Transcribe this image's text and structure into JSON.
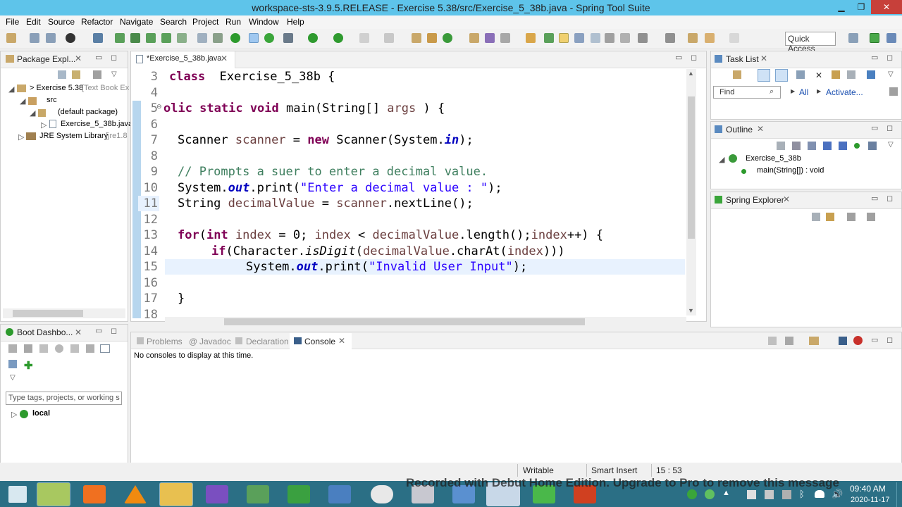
{
  "window": {
    "title": "workspace-sts-3.9.5.RELEASE - Exercise 5.38/src/Exercise_5_38b.java - Spring Tool Suite",
    "minimize": "▁",
    "maximize": "❐",
    "close": "✕"
  },
  "menu": [
    "File",
    "Edit",
    "Source",
    "Refactor",
    "Navigate",
    "Search",
    "Project",
    "Run",
    "Window",
    "Help"
  ],
  "toolbar": {
    "quick_access": "Quick Access"
  },
  "package_explorer": {
    "tab": "Package Expl...",
    "project": "> Exercise 5.38",
    "project_suffix": "[Text Book Ex",
    "src": "src",
    "default_package": "(default package)",
    "file": "Exercise_5_38b.java",
    "jre": "JRE System Library",
    "jre_suffix": "[jre1.8"
  },
  "boot_dashboard": {
    "tab": "Boot Dashbo...",
    "filter_placeholder": "Type tags, projects, or working s",
    "local": "local"
  },
  "editor": {
    "tab": "*Exercise_5_38b.java",
    "line_numbers": [
      "3",
      "4",
      "5",
      "6",
      "7",
      "8",
      "9",
      "10",
      "11",
      "12",
      "13",
      "14",
      "15",
      "16",
      "17",
      "18"
    ]
  },
  "task_list": {
    "tab": "Task List",
    "find_placeholder": "Find",
    "all": "All",
    "activate": "Activate..."
  },
  "outline": {
    "tab": "Outline",
    "class": "Exercise_5_38b",
    "method": "main(String[]) : void"
  },
  "spring_explorer": {
    "tab": "Spring Explorer"
  },
  "bottom": {
    "tabs": [
      "Problems",
      "Javadoc",
      "Declaration",
      "Console"
    ],
    "console_message": "No consoles to display at this time."
  },
  "status": {
    "writable": "Writable",
    "insert": "Smart Insert",
    "position": "15 : 53"
  },
  "taskbar": {
    "time": "09:40 AM",
    "date": "2020-11-17"
  },
  "watermark": "Recorded with Debut Home Edition. Upgrade to Pro to remove this message",
  "colors": {
    "title_bar": "#5ec4ea",
    "taskbar": "#2b6f85",
    "keyword": "#7f0055",
    "string": "#2a00ff",
    "comment": "#3f7f5f"
  }
}
